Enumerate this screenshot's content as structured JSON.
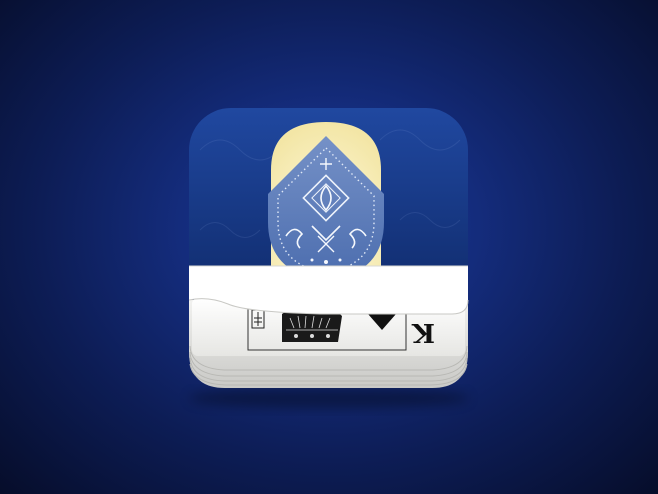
{
  "app_icon": {
    "icon_name": "playing-cards-icon",
    "card_rank": "K",
    "colors": {
      "background_center": "#1e3a9a",
      "background_edge": "#060d2a",
      "tile_top": "#2048a0",
      "tile_bottom": "#0f2a6a",
      "glow": "#fbf3c4",
      "card_back": "#5e7fbc",
      "card_ornament": "#e8eef8",
      "paper": "#f5f5f3",
      "ink": "#111111"
    }
  }
}
